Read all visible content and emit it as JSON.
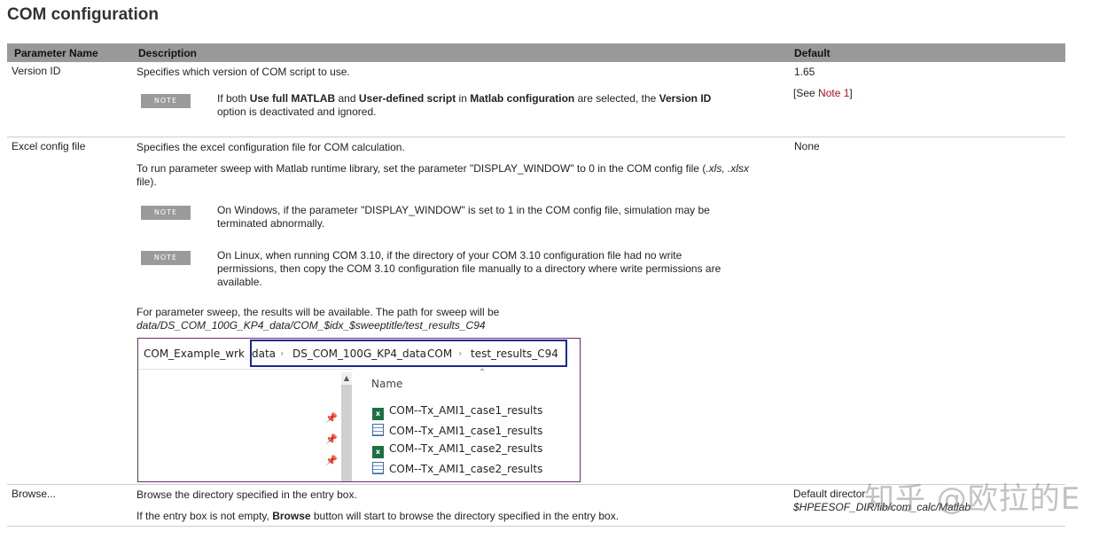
{
  "page": {
    "title": "COM configuration"
  },
  "table": {
    "headers": {
      "param": "Parameter Name",
      "desc": "Description",
      "default": "Default"
    },
    "rows": {
      "version": {
        "name": "Version ID",
        "desc": "Specifies which version of COM script to use.",
        "default": "1.65",
        "default_ref_pre": "[See ",
        "default_ref_link": "Note 1",
        "default_ref_post": "]",
        "note": {
          "badge": "NOTE",
          "p1": "If both ",
          "b1": "Use full MATLAB",
          "p2": " and ",
          "b2": "User-defined script",
          "p3": " in ",
          "b3": "Matlab configuration",
          "p4": " are selected, the ",
          "b4": "Version ID",
          "line2": "option is deactivated and ignored."
        }
      },
      "excel": {
        "name": "Excel config file",
        "default": "None",
        "desc1": "Specifies the excel configuration file for COM calculation.",
        "desc2_a": "To run parameter sweep with Matlab runtime library, set the parameter \"DISPLAY_WINDOW\" to 0 in the COM config file (",
        "desc2_ext": ".xls, .xlsx",
        "desc2_b": "file).",
        "note1": {
          "badge": "NOTE",
          "line1": "On Windows, if the parameter \"DISPLAY_WINDOW\" is set to 1 in the COM config file, simulation may be",
          "line2": "terminated abnormally."
        },
        "note2": {
          "badge": "NOTE",
          "line1": "On Linux, when running COM 3.10, if the directory of your COM 3.10 configuration file had no write",
          "line2": "permissions, then copy the COM 3.10 configuration file manually to a directory where write permissions are",
          "line3": "available."
        },
        "sweep_line1": "For parameter sweep, the results will be available. The path for sweep will be",
        "sweep_path": "data/DS_COM_100G_KP4_data/COM_$idx_$sweeptitle/test_results_C94"
      },
      "browse": {
        "name": "Browse...",
        "desc1": "Browse the directory specified in the entry box.",
        "desc2_a": "If the entry box is not empty, ",
        "desc2_b": "Browse",
        "desc2_c": " button will start to browse the directory specified in the entry box.",
        "default1": "Default director",
        "default2": "$HPEESOF_DIR/lib/com_calc/Matlab"
      }
    }
  },
  "explorer": {
    "crumbs": [
      "COM_Example_wrk",
      "data",
      "DS_COM_100G_KP4_data",
      "COM",
      "test_results_C94"
    ],
    "separator": "›",
    "column_header": "Name",
    "files": [
      {
        "name": "COM--Tx_AMI1_case1_results",
        "icon": "excel-icon"
      },
      {
        "name": "COM--Tx_AMI1_case1_results",
        "icon": "table-icon"
      },
      {
        "name": "COM--Tx_AMI1_case2_results",
        "icon": "excel-icon"
      },
      {
        "name": "COM--Tx_AMI1_case2_results",
        "icon": "table-icon"
      }
    ]
  },
  "watermark": "知乎 @欧拉的E"
}
